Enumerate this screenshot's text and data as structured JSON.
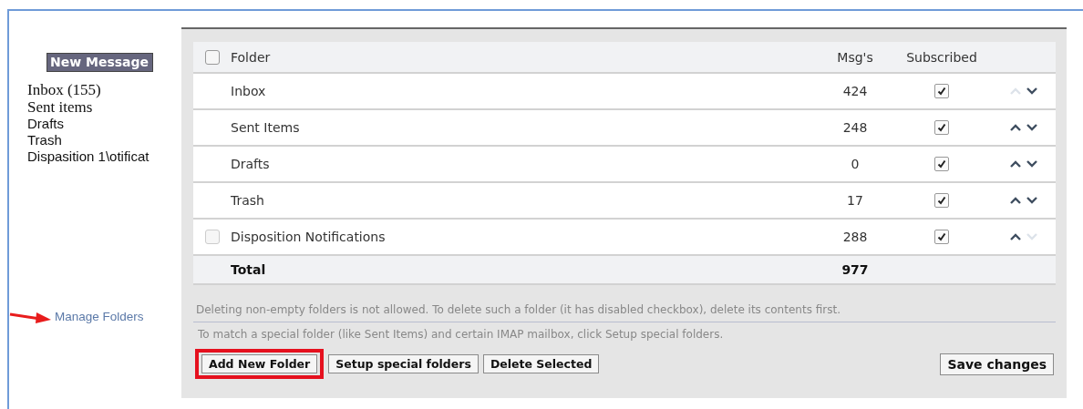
{
  "sidebar": {
    "new_message": "New Message",
    "folders": [
      {
        "label": "Inbox (155)",
        "kind": "serif"
      },
      {
        "label": "Sent items",
        "kind": "serif"
      },
      {
        "label": "Drafts",
        "kind": "sans"
      },
      {
        "label": "Trash",
        "kind": "sans"
      },
      {
        "label": "Dispasition 1\\otificat",
        "kind": "sans"
      }
    ],
    "manage_folders": "Manage Folders"
  },
  "table": {
    "columns": [
      "Folder",
      "Msg's",
      "Subscribed"
    ],
    "header_checked": false,
    "rows": [
      {
        "folder": "Inbox",
        "msgs": "424",
        "subscribed": true,
        "kind": "plain",
        "up_enabled": false,
        "down_enabled": true
      },
      {
        "folder": "Sent Items",
        "msgs": "248",
        "subscribed": true,
        "kind": "plain",
        "up_enabled": true,
        "down_enabled": true
      },
      {
        "folder": "Drafts",
        "msgs": "0",
        "subscribed": true,
        "kind": "plain",
        "up_enabled": true,
        "down_enabled": true
      },
      {
        "folder": "Trash",
        "msgs": "17",
        "subscribed": true,
        "kind": "plain",
        "up_enabled": true,
        "down_enabled": true
      },
      {
        "folder": "Disposition Notifications",
        "msgs": "288",
        "subscribed": true,
        "kind": "selectable",
        "checked": false,
        "up_enabled": true,
        "down_enabled": false
      }
    ],
    "total_label": "Total",
    "total_msgs": "977"
  },
  "notes": [
    "Deleting non-empty folders is not allowed. To delete such a folder (it has disabled checkbox), delete its contents first.",
    "To match a special folder (like Sent Items) and certain IMAP mailbox, click Setup special folders."
  ],
  "buttons": [
    {
      "label": "Add New Folder",
      "highlighted": true
    },
    {
      "label": "Setup special folders",
      "highlighted": false
    },
    {
      "label": "Delete Selected",
      "highlighted": false
    }
  ],
  "save_button": "Save changes"
}
